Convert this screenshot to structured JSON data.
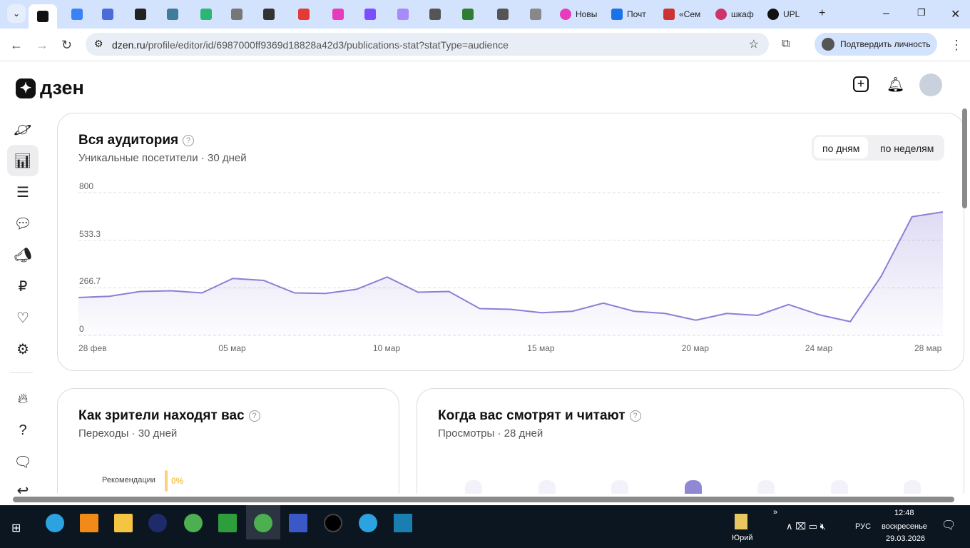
{
  "browser": {
    "tabs": [
      {
        "label": "Новы"
      },
      {
        "label": "Почт"
      },
      {
        "label": "«Сем"
      },
      {
        "label": "шкаф"
      },
      {
        "label": "UPL"
      }
    ],
    "url_host": "dzen.ru",
    "url_path": "/profile/editor/id/6987000ff9369d18828a42d3/publications-stat?statType=audience",
    "verify_label": "Подтвердить личность"
  },
  "header": {
    "logo": "дзен"
  },
  "audience": {
    "title": "Вся аудитория",
    "subtitle": "Уникальные посетители",
    "period": "30 дней",
    "toggle": [
      "по дням",
      "по неделям"
    ],
    "selected": "по дням"
  },
  "chart_data": {
    "type": "area",
    "title": "Вся аудитория",
    "ylim": [
      0,
      800
    ],
    "yticks": [
      "800",
      "533.3",
      "266.7",
      "0"
    ],
    "xticks": [
      {
        "label": "28 фев",
        "i": 0
      },
      {
        "label": "05 мар",
        "i": 5
      },
      {
        "label": "10 мар",
        "i": 10
      },
      {
        "label": "15 мар",
        "i": 15
      },
      {
        "label": "20 мар",
        "i": 20
      },
      {
        "label": "24 мар",
        "i": 24
      },
      {
        "label": "28 мар",
        "i": 28
      }
    ],
    "values": [
      212,
      219,
      246,
      250,
      238,
      319,
      308,
      238,
      235,
      258,
      327,
      242,
      246,
      150,
      146,
      127,
      135,
      181,
      135,
      123,
      85,
      123,
      112,
      173,
      115,
      77,
      331,
      665,
      692
    ],
    "color": "#8b7fd6"
  },
  "sources": {
    "title": "Как зрители находят вас",
    "subtitle": "Переходы",
    "period": "30 дней",
    "rows": [
      {
        "label": "Рекомендации",
        "value": "0%"
      }
    ]
  },
  "when": {
    "title": "Когда вас смотрят и читают",
    "subtitle": "Просмотры",
    "period": "28 дней"
  },
  "taskbar": {
    "user": "Юрий",
    "lang": "РУС",
    "time": "12:48",
    "weekday": "воскресенье",
    "date": "29.03.2026"
  }
}
